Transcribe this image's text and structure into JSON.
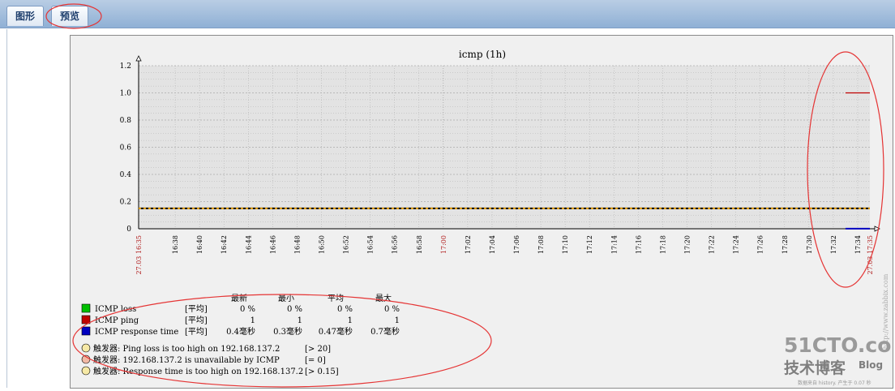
{
  "tabs": [
    {
      "label": "图形"
    },
    {
      "label": "预览"
    }
  ],
  "chart_data": {
    "type": "line",
    "title": "icmp (1h)",
    "ylim": [
      0,
      1.2
    ],
    "y_ticks": [
      "1.2",
      "1.0",
      "0.8",
      "0.6",
      "0.4",
      "0.2",
      "0"
    ],
    "x_ticks": [
      "27.03 16:35",
      "16:38",
      "16:40",
      "16:42",
      "16:44",
      "16:46",
      "16:48",
      "16:50",
      "16:52",
      "16:54",
      "16:56",
      "16:58",
      "17:00",
      "17:02",
      "17:04",
      "17:06",
      "17:08",
      "17:10",
      "17:12",
      "17:14",
      "17:16",
      "17:18",
      "17:20",
      "17:22",
      "17:24",
      "17:26",
      "17:28",
      "17:30",
      "17:32",
      "17:34",
      "27.03 17:35"
    ],
    "grid": true,
    "series": [
      {
        "name": "ICMP ping",
        "color": "#c00000",
        "x": [
          "17:33",
          "17:35"
        ],
        "values": [
          1,
          1
        ]
      },
      {
        "name": "ICMP response time",
        "color": "#0000c0",
        "x": [
          "17:33",
          "17:35"
        ],
        "values": [
          0.0004,
          0.0004
        ]
      }
    ],
    "trigger_line": {
      "value": 0.15,
      "color": "#e8a000"
    },
    "watermark": "http://www.zabbix.com"
  },
  "legend": {
    "headers": [
      "最新",
      "最小",
      "平均",
      "最大"
    ],
    "items": [
      {
        "name": "ICMP loss",
        "func": "[平均]",
        "color": "#00c000",
        "last": "0 %",
        "min": "0 %",
        "avg": "0 %",
        "max": "0 %"
      },
      {
        "name": "ICMP ping",
        "func": "[平均]",
        "color": "#c00000",
        "last": "1",
        "min": "1",
        "avg": "1",
        "max": "1"
      },
      {
        "name": "ICMP response time",
        "func": "[平均]",
        "color": "#0000c0",
        "last": "0.4毫秒",
        "min": "0.3毫秒",
        "avg": "0.47毫秒",
        "max": "0.7毫秒"
      }
    ],
    "triggers": [
      {
        "text": "触发器: Ping loss is too high on 192.168.137.2",
        "cond": "[> 20]",
        "color": "#f6e9a6"
      },
      {
        "text": "触发器: 192.168.137.2 is unavailable by ICMP",
        "cond": "[= 0]",
        "color": "#f2b9a5"
      },
      {
        "text": "触发器: Response time is too high on 192.168.137.2",
        "cond": "[> 0.15]",
        "color": "#f6e9a6"
      }
    ]
  },
  "branding": {
    "logo": "51CTO.com",
    "sub1": "技术博客",
    "sub2": "Blog",
    "footer": "数据来自 history. 产生于 0.07 秒"
  }
}
